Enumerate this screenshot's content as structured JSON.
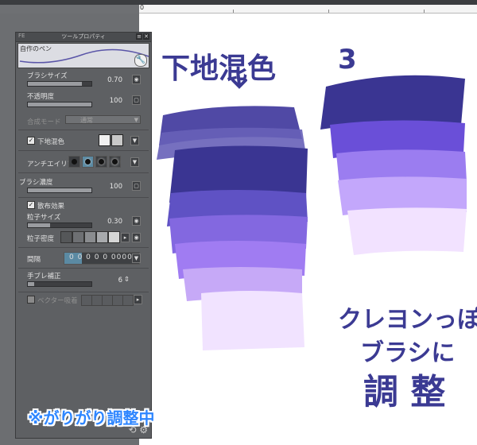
{
  "ruler": {
    "origin_label": "0"
  },
  "panel": {
    "title": "ツールプロパティ",
    "pin_label": "FE",
    "brush_name": "自作のペン",
    "brush_size": {
      "label": "ブラシサイズ",
      "value": "0.70",
      "level": 0.85
    },
    "opacity": {
      "label": "不透明度",
      "value": "100",
      "level": 1.0
    },
    "blend_mode": {
      "label": "合成モード",
      "value": "通常"
    },
    "underlay_mix": {
      "label": "下地混色",
      "checked": true
    },
    "antialias": {
      "label": "アンチエイリアス"
    },
    "brush_density": {
      "label": "ブラシ濃度",
      "value": "100",
      "level": 1.0
    },
    "scatter": {
      "label": "散布効果",
      "checked": true
    },
    "particle_size": {
      "label": "粒子サイズ",
      "value": "0.30",
      "level": 0.35
    },
    "particle_density": {
      "label": "粒子密度"
    },
    "interval": {
      "label": "間隔",
      "value": "0  0 0 0 0 0000"
    },
    "stabilization": {
      "label": "手ブレ補正",
      "value": "6",
      "level": 0.1
    },
    "vector_snap": {
      "label": "ベクター吸着",
      "checked": false
    }
  },
  "status_text": "※がりがり調整中",
  "canvas": {
    "note_top_left": "下地混色",
    "note_top_right": "3",
    "note_bottom_line1": "クレヨンっぽ",
    "note_bottom_line2": "ブラシに",
    "note_bottom_line3": "調 整"
  },
  "colors": {
    "ink": "#3b3a93",
    "stroke_dark": "#3a3592",
    "stroke_light": "#f3e8ff",
    "status_blue": "#2e86ff"
  }
}
